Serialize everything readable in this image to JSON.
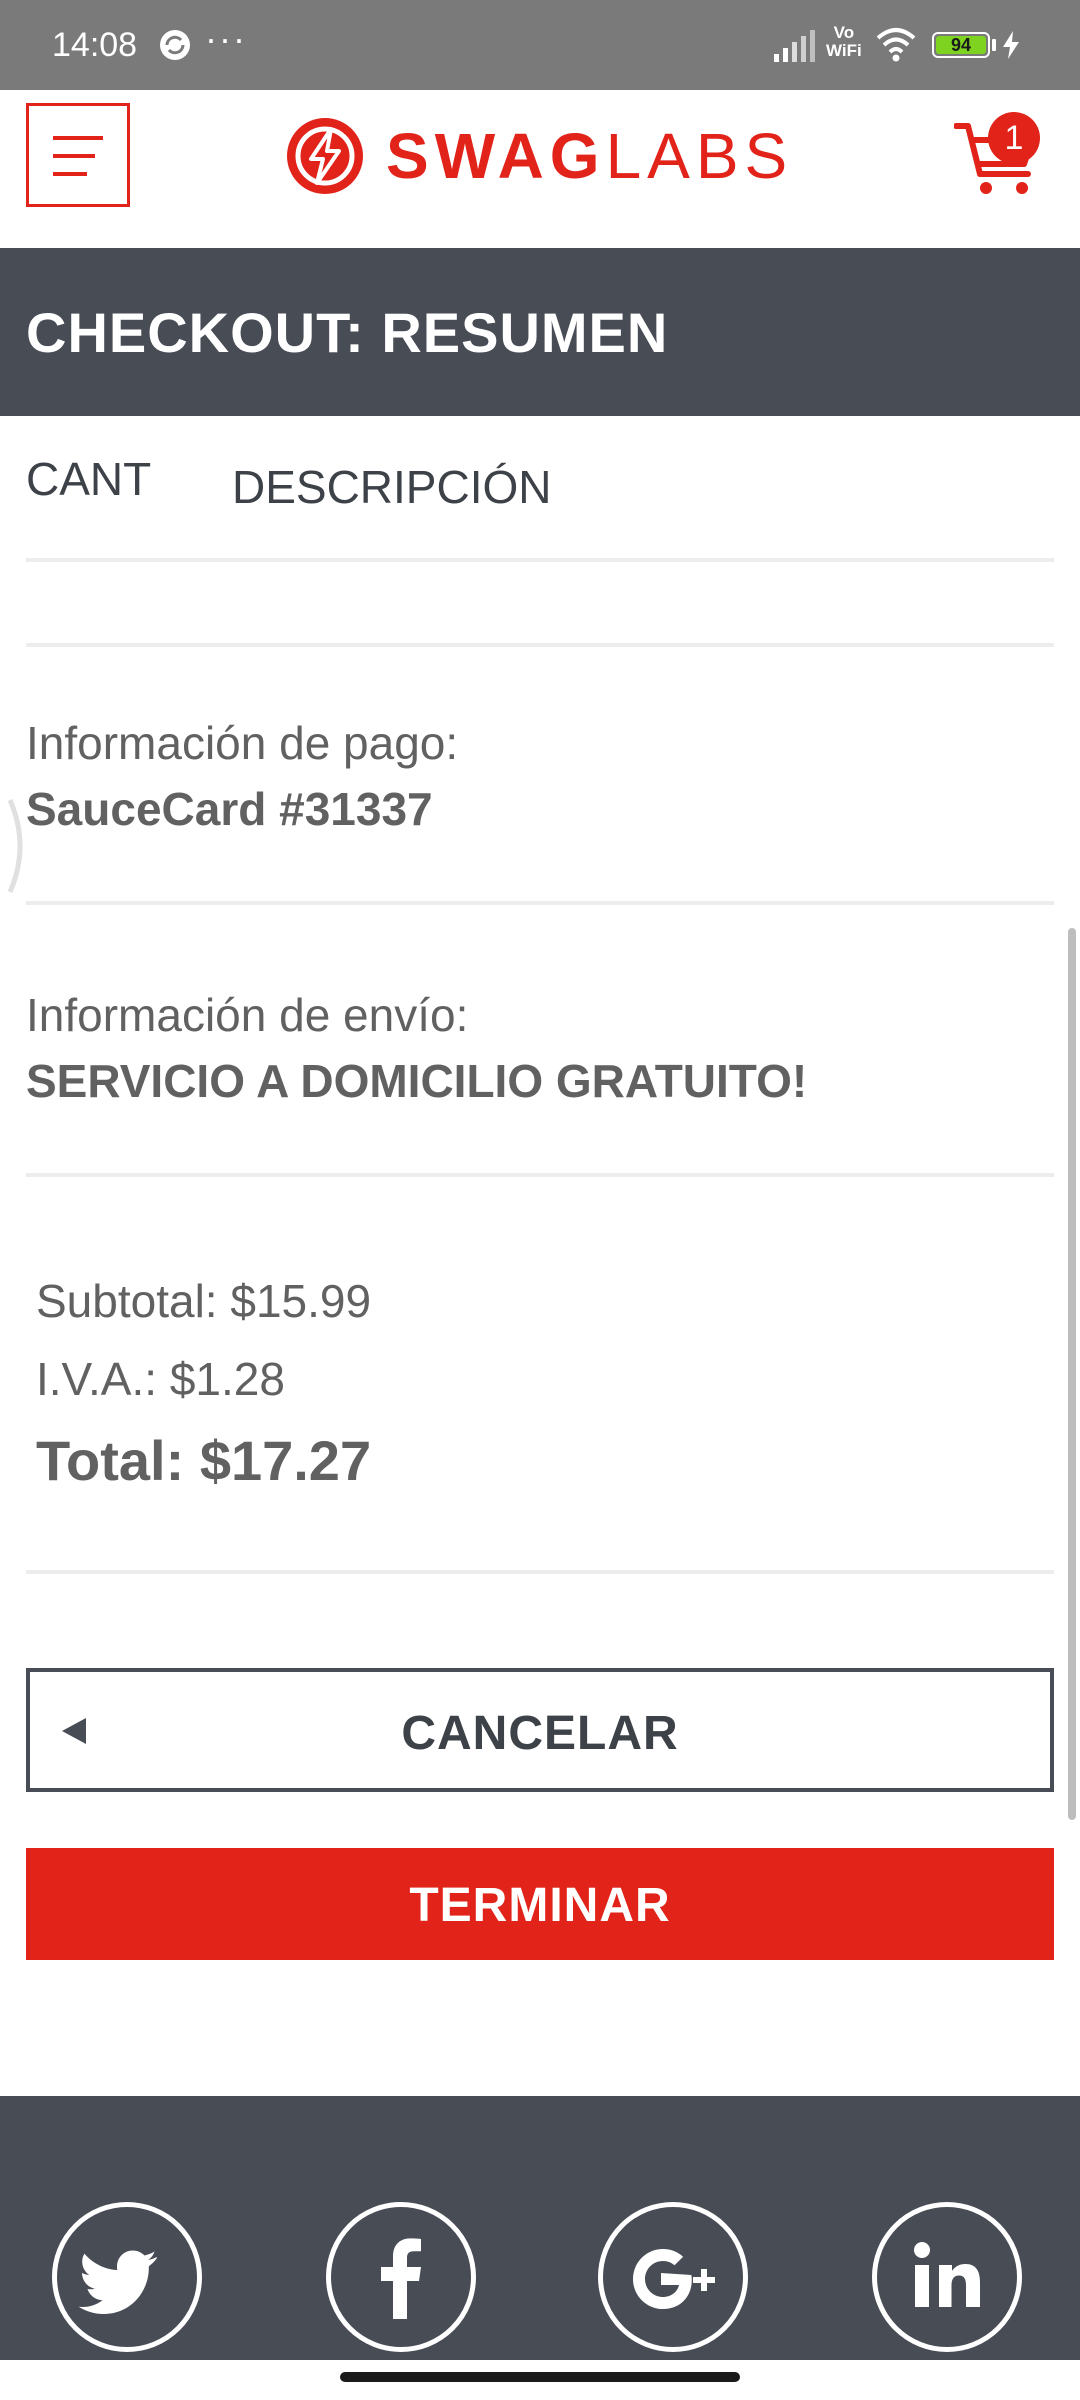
{
  "status_bar": {
    "time": "14:08",
    "more": "···",
    "vo": "Vo",
    "wifi_label": "WiFi",
    "battery": "94",
    "icons": [
      "sync-icon",
      "signal-icon",
      "wifi-icon",
      "battery-icon",
      "charging-icon"
    ]
  },
  "header": {
    "logo_swag": "SWAG",
    "logo_labs": "LABS",
    "cart_count": "1",
    "icons": [
      "menu-icon",
      "logo-bolt-icon",
      "cart-icon"
    ]
  },
  "page": {
    "title": "CHECKOUT: RESUMEN"
  },
  "columns": {
    "qty": "CANT",
    "description": "DESCRIPCIÓN"
  },
  "payment": {
    "label": "Información de pago:",
    "value": "SauceCard #31337"
  },
  "shipping": {
    "label": "Información de envío:",
    "value": "SERVICIO A DOMICILIO GRATUITO!"
  },
  "summary": {
    "subtotal": "Subtotal: $15.99",
    "tax": "I.V.A.: $1.28",
    "total": "Total: $17.27"
  },
  "actions": {
    "cancel": "CANCELAR",
    "finish": "TERMINAR"
  },
  "footer": {
    "social": [
      "twitter-icon",
      "facebook-icon",
      "google-plus-icon",
      "linkedin-icon"
    ]
  },
  "colors": {
    "brand_red": "#e2231a",
    "dark_bar": "#484c55",
    "text_gray": "#616161"
  }
}
